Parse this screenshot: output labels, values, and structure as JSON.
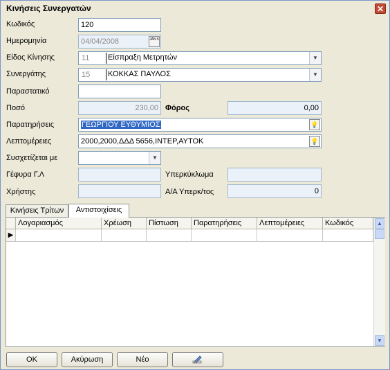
{
  "window": {
    "title": "Κινήσεις Συνεργατών",
    "close_symbol": "✕"
  },
  "form": {
    "code": {
      "label": "Κωδικός",
      "value": "120"
    },
    "date": {
      "label": "Ημερομηνία",
      "value": "04/04/2008",
      "icon_text": "JAN 5"
    },
    "movement_type": {
      "label": "Είδος Κίνησης",
      "code": "11",
      "value": "Είσπραξη Μετρητών"
    },
    "partner": {
      "label": "Συνεργάτης",
      "code": "15",
      "value": "ΚΟΚΚΑΣ ΠΑΥΛΟΣ"
    },
    "document": {
      "label": "Παραστατικό",
      "value": ""
    },
    "amount": {
      "label": "Ποσό",
      "value": "230,00"
    },
    "tax": {
      "label": "Φόρος",
      "value": "0,00"
    },
    "remarks": {
      "label": "Παρατηρήσεις",
      "value": "ΓΕΩΡΓΙΟΥ ΕΥΘΥΜΙΟΣ"
    },
    "details": {
      "label": "Λεπτομέρειες",
      "value": "2000,2000,ΔΔΔ 5656,ΙΝΤΕΡ,ΑΥΤΟΚ"
    },
    "related": {
      "label": "Συσχετίζεται με",
      "value": ""
    },
    "bridge": {
      "label": "Γέφυρα Γ.Λ",
      "value": ""
    },
    "overdraft": {
      "label": "Υπερκύκλωμα",
      "value": ""
    },
    "user": {
      "label": "Χρήστης",
      "value": ""
    },
    "overdraft_no": {
      "label": "Α/Α Υπερκ/τος",
      "value": "0"
    }
  },
  "tabs": [
    {
      "label": "Κινήσεις Τρίτων",
      "active": false
    },
    {
      "label": "Αντιστοιχίσεις",
      "active": true
    }
  ],
  "grid": {
    "columns": [
      "Λογαριασμός",
      "Χρέωση",
      "Πίστωση",
      "Παρατηρήσεις",
      "Λεπτομέρειες",
      "Κωδικός"
    ],
    "rows": [
      [
        "",
        "",
        "",
        "",
        "",
        ""
      ]
    ],
    "row_indicator": "▶"
  },
  "buttons": {
    "ok": "OK",
    "cancel": "Ακύρωση",
    "new": "Νέο",
    "edit_icon": "edit-icon"
  },
  "colors": {
    "selection": "#3168c6",
    "window_bg": "#ece9d8",
    "field_border": "#7f9db9"
  }
}
